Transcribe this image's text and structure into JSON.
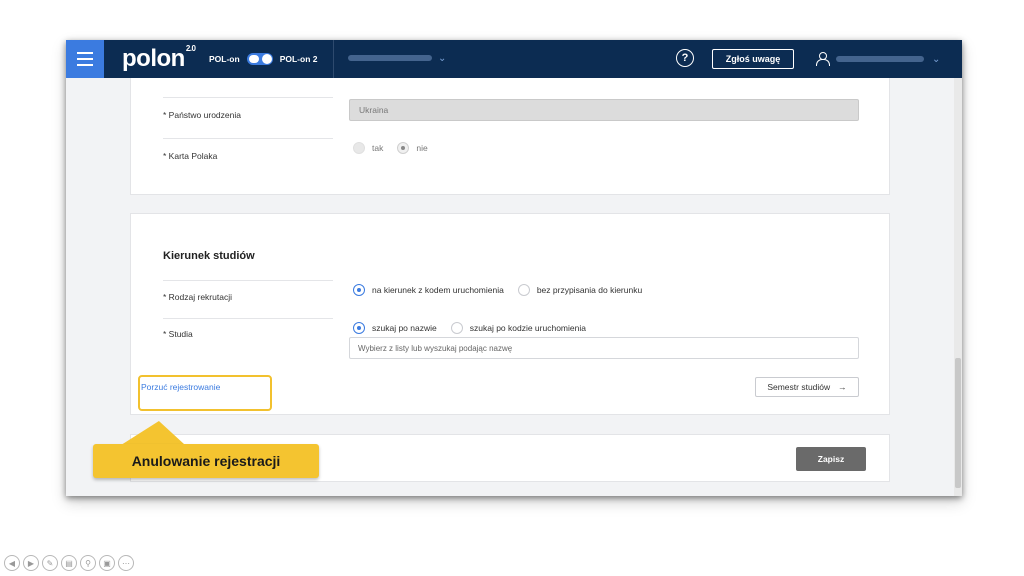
{
  "topbar": {
    "logo_text": "polon",
    "logo_version": "2.0",
    "toggle_left": "POL-on",
    "toggle_right": "POL-on 2",
    "help_symbol": "?",
    "report_label": "Zgłoś uwagę"
  },
  "form_top": {
    "country_label": "* Państwo urodzenia",
    "country_value": "Ukraina",
    "card_label": "* Karta Polaka",
    "card_options": [
      "tak",
      "nie"
    ],
    "card_selected": "nie"
  },
  "studies": {
    "section_title": "Kierunek studiów",
    "recruitment_label": "* Rodzaj rekrutacji",
    "recruitment_options": [
      "na kierunek z kodem uruchomienia",
      "bez przypisania do kierunku"
    ],
    "recruitment_selected": "na kierunek z kodem uruchomienia",
    "studies_label": "* Studia",
    "studies_options": [
      "szukaj po nazwie",
      "szukaj po kodzie uruchomienia"
    ],
    "studies_selected": "szukaj po nazwie",
    "search_placeholder": "Wybierz z listy lub wyszukaj podając nazwę",
    "abandon_link": "Porzuć rejestrowanie",
    "semester_button": "Semestr studiów",
    "semester_arrow": "→"
  },
  "footer": {
    "save_button": "Zapisz"
  },
  "callout": {
    "text": "Anulowanie rejestracji"
  },
  "player_icons": [
    "prev-icon",
    "next-icon",
    "pen-icon",
    "highlighter-icon",
    "zoom-icon",
    "subtitles-icon",
    "more-icon"
  ],
  "colors": {
    "topbar": "#0c2c52",
    "accent": "#3b7be0",
    "callout": "#f4c430"
  }
}
